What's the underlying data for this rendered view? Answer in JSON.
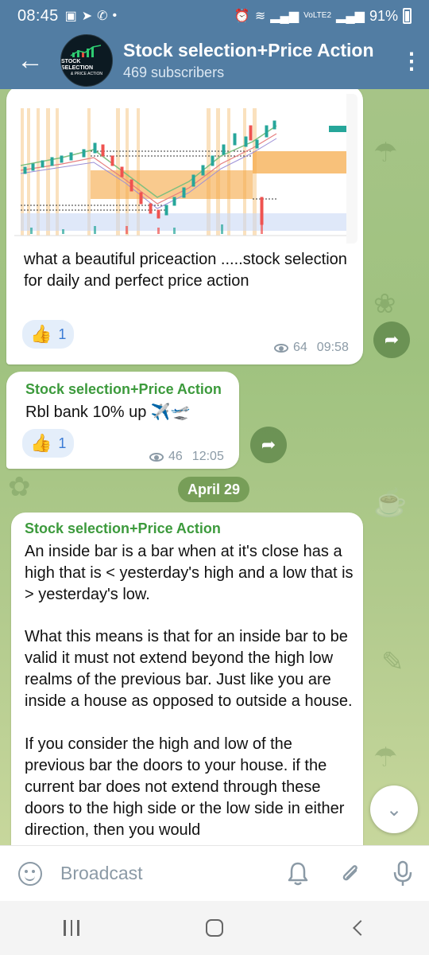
{
  "status_bar": {
    "time": "08:45",
    "battery": "91%",
    "network": "VoLTE2",
    "icons": [
      "gallery-icon",
      "telegram-icon",
      "whatsapp-icon",
      "dot-icon"
    ]
  },
  "header": {
    "title": "Stock selection+Price Action",
    "subscribers": "469 subscribers",
    "avatar_text_1": "STOCK SELECTION",
    "avatar_text_2": "& PRICE ACTION"
  },
  "messages": [
    {
      "text": "what a beautiful priceaction .....stock selection for  daily and perfect price action",
      "reaction_emoji": "👍",
      "reaction_count": "1",
      "views": "64",
      "time": "09:58"
    },
    {
      "sender": "Stock selection+Price Action",
      "text": "Rbl bank 10% up ✈️🛫",
      "reaction_emoji": "👍",
      "reaction_count": "1",
      "views": "46",
      "time": "12:05"
    },
    {
      "sender": "Stock selection+Price Action",
      "paragraph_1": "An inside bar is a bar when at it's close has a high that is < yesterday's high and a low that is > yesterday's low.",
      "paragraph_2": "What this means is that for an inside bar to be valid it must not extend beyond the high low realms of the previous bar. Just like you are inside a house as opposed to outside a house.",
      "paragraph_3": "If you consider the high and low of the previous bar the doors to your house. if the current bar does not extend through these doors to the high side or the low side in either direction, then you would"
    }
  ],
  "date_separator": "April 29",
  "input": {
    "placeholder": "Broadcast"
  },
  "colors": {
    "header": "#527da3",
    "sender": "#3c9a3c",
    "reaction_count": "#3a7bd5",
    "meta": "#8b9aa6"
  }
}
